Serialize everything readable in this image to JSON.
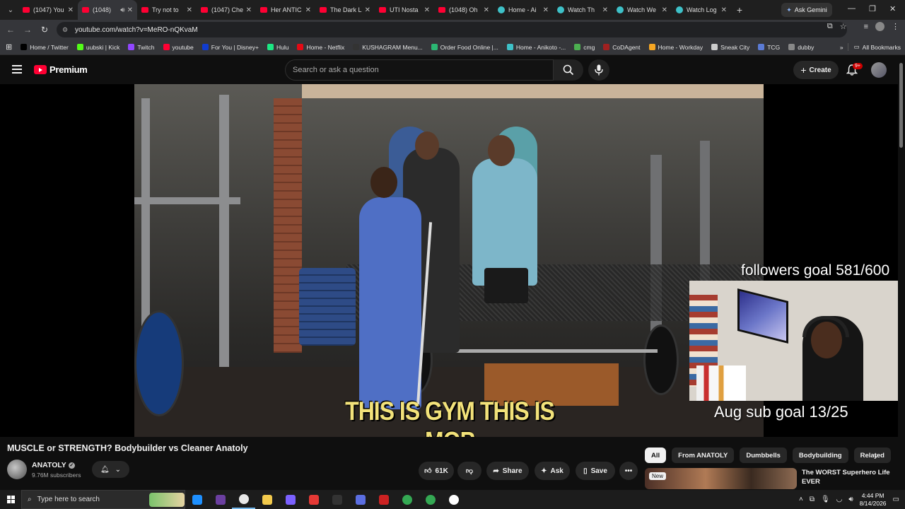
{
  "browser": {
    "tabs": [
      {
        "label": "(1047) You",
        "favicon": "youtube",
        "active": false
      },
      {
        "label": "(1048)",
        "favicon": "youtube",
        "active": true
      },
      {
        "label": "Try not to",
        "favicon": "youtube",
        "active": false
      },
      {
        "label": "(1047) Che",
        "favicon": "youtube",
        "active": false
      },
      {
        "label": "Her ANTIC",
        "favicon": "youtube",
        "active": false
      },
      {
        "label": "The Dark L",
        "favicon": "youtube",
        "active": false
      },
      {
        "label": "UTI Nosta",
        "favicon": "youtube",
        "active": false
      },
      {
        "label": "(1048) Oh",
        "favicon": "youtube",
        "active": false
      },
      {
        "label": "Home - Ai",
        "favicon": "globe",
        "active": false
      },
      {
        "label": "Watch Th",
        "favicon": "globe",
        "active": false
      },
      {
        "label": "Watch We",
        "favicon": "globe",
        "active": false
      },
      {
        "label": "Watch Log",
        "favicon": "globe",
        "active": false
      }
    ],
    "new_tab_symbol": "+",
    "ask_gemini": "Ask Gemini",
    "url": "youtube.com/watch?v=MeRO-nQKvaM",
    "bookmarks": [
      {
        "label": "Home / Twitter",
        "color": "#000000"
      },
      {
        "label": "uubski | Kick",
        "color": "#53fc18"
      },
      {
        "label": "Twitch",
        "color": "#9146ff"
      },
      {
        "label": "youtube",
        "color": "#ff0033"
      },
      {
        "label": "For You | Disney+",
        "color": "#113ccf"
      },
      {
        "label": "Hulu",
        "color": "#1ce783"
      },
      {
        "label": "Home - Netflix",
        "color": "#e50914"
      },
      {
        "label": "KUSHAGRAM Menu...",
        "color": "#333333"
      },
      {
        "label": "Order Food Online |...",
        "color": "#2bb673"
      },
      {
        "label": "Home - Anikoto -...",
        "color": "#3ec1c8"
      },
      {
        "label": "cmg",
        "color": "#4caf50"
      },
      {
        "label": "CoDAgent",
        "color": "#a02020"
      },
      {
        "label": "Home - Workday",
        "color": "#f5a623"
      },
      {
        "label": "Sneak City",
        "color": "#cccccc"
      },
      {
        "label": "TCG",
        "color": "#5b7bd5"
      },
      {
        "label": "dubby",
        "color": "#888888"
      }
    ],
    "all_bookmarks": "All Bookmarks"
  },
  "youtube": {
    "brand": "Premium",
    "search_placeholder": "Search or ask a question",
    "create_label": "Create",
    "notifications_count": "9+",
    "video": {
      "subtitle": "THIS IS GYM THIS IS MOP",
      "overlay_followers": "followers goal 581/600",
      "overlay_subs": "Aug sub goal 13/25"
    },
    "title": "MUSCLE or STRENGTH? Bodybuilder vs Cleaner Anatoly",
    "channel": {
      "name": "ANATOLY",
      "subscribers": "9.76M subscribers"
    },
    "actions": {
      "likes": "61K",
      "share": "Share",
      "ask": "Ask",
      "save": "Save"
    },
    "chips": [
      "All",
      "From ANATOLY",
      "Dumbbells",
      "Bodybuilding",
      "Related"
    ],
    "recommendation": {
      "badge": "New",
      "title": "The WORST Superhero Life EVER"
    }
  },
  "taskbar": {
    "search_placeholder": "Type here to search",
    "time": "4:44 PM",
    "date": "8/14/2026"
  }
}
